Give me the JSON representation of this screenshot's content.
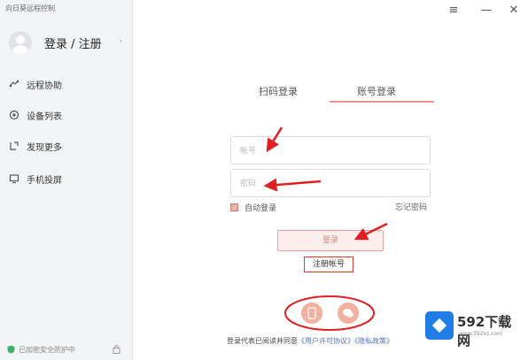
{
  "app": {
    "title": "向日葵远程控制"
  },
  "sidebar": {
    "login_label": "登录 / 注册",
    "items": [
      {
        "label": "远程协助",
        "icon": "remote-assist-icon"
      },
      {
        "label": "设备列表",
        "icon": "device-list-icon"
      },
      {
        "label": "发现更多",
        "icon": "discover-icon"
      },
      {
        "label": "手机投屏",
        "icon": "screen-cast-icon"
      }
    ],
    "footer_text": "已加密安全防护中"
  },
  "window": {
    "menu_icon": "menu-icon",
    "close_icon": "close-icon"
  },
  "tabs": [
    {
      "label": "扫码登录",
      "active": false
    },
    {
      "label": "账号登录",
      "active": true
    }
  ],
  "form": {
    "account_placeholder": "帐号",
    "password_placeholder": "密码",
    "auto_login_label": "自动登录",
    "forgot_label": "忘记密码",
    "login_button": "登录",
    "register_link": "注册帐号"
  },
  "third_party": [
    {
      "icon": "phone-login-icon"
    },
    {
      "icon": "wechat-login-icon"
    }
  ],
  "agreement": {
    "prefix": "登录代表已阅读并同意",
    "link1": "《用户许可协议》",
    "link2": "《隐私政策》"
  },
  "watermark": {
    "name": "592下载网",
    "url": "www.592xz.com"
  },
  "colors": {
    "accent": "#e34b3f",
    "sidebar_bg": "#f3f4f6",
    "annotation": "#e02020"
  }
}
